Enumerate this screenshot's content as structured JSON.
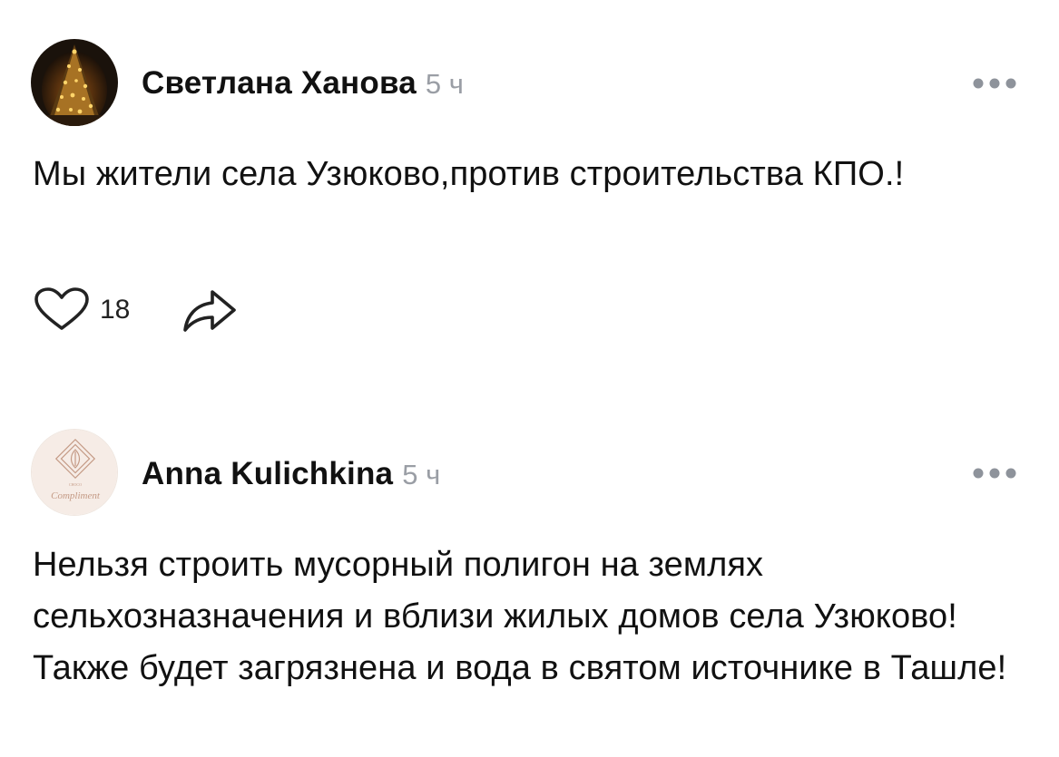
{
  "comments": [
    {
      "author": "Светлана Ханова",
      "time": "5 ч",
      "text": "Мы жители села Узюково,против строительства КПО.!",
      "likes": "18",
      "avatar_icon": "christmas-tree-photo",
      "more_icon": "more-dots-icon",
      "like_icon": "heart-outline-icon",
      "share_icon": "share-arrow-icon"
    },
    {
      "author": "Anna Kulichkina",
      "time": "5 ч",
      "text": "Нельзя строить мусорный полигон на землях сельхозназначения и вблизи жилых домов села Узюково!Также будет загрязнена и вода в святом источнике в Ташле!",
      "avatar_icon": "choco-compliment-logo",
      "avatar_logo_text": "Compliment",
      "more_icon": "more-dots-icon"
    }
  ],
  "colors": {
    "text": "#111111",
    "time": "#9a9ea5",
    "icon": "#8e939b"
  }
}
